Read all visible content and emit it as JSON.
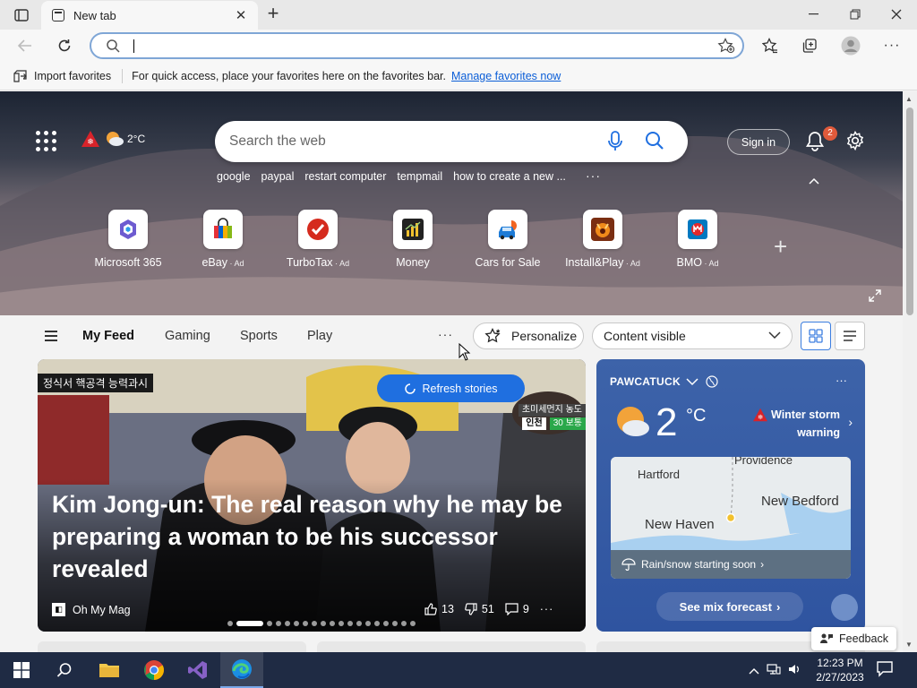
{
  "browser": {
    "tab_title": "New tab",
    "address_placeholder": "",
    "favorites_bar": {
      "import_label": "Import favorites",
      "message": "For quick access, place your favorites here on the favorites bar.",
      "manage_link": "Manage favorites now"
    }
  },
  "hero": {
    "weather_temp": "2°C",
    "search_placeholder": "Search the web",
    "trending": [
      "google",
      "paypal",
      "restart computer",
      "tempmail",
      "how to create a new ..."
    ],
    "sign_in_label": "Sign in",
    "notification_count": "2",
    "quick_links": [
      {
        "name": "Microsoft 365",
        "ad": ""
      },
      {
        "name": "eBay",
        "ad": " · Ad"
      },
      {
        "name": "TurboTax",
        "ad": " · Ad"
      },
      {
        "name": "Money",
        "ad": ""
      },
      {
        "name": "Cars for Sale",
        "ad": ""
      },
      {
        "name": "Install&Play",
        "ad": " · Ad"
      },
      {
        "name": "BMO",
        "ad": " · Ad"
      }
    ]
  },
  "feed_nav": {
    "tabs": [
      "My Feed",
      "Gaming",
      "Sports",
      "Play"
    ],
    "personalize_label": "Personalize",
    "content_dropdown": "Content visible"
  },
  "story": {
    "refresh_label": "Refresh stories",
    "headline": "Kim Jong-un: The real reason why he may be preparing a woman to be his successor revealed",
    "source": "Oh My Mag",
    "likes": "13",
    "dislikes": "51",
    "comments": "9",
    "overlay_text_left": "정식서 핵공격 능력과시",
    "overlay_text_right_1": "초미세먼지 농도",
    "overlay_text_right_2": "인천",
    "overlay_text_right_3": "30 보통"
  },
  "weather_card": {
    "location": "PAWCATUCK",
    "temperature": "2",
    "unit": "°C",
    "alert_line1": "Winter storm",
    "alert_line2": "warning",
    "map_labels": [
      "Hartford",
      "Providence",
      "New Bedford",
      "New Haven"
    ],
    "precip_text": "Rain/snow starting soon",
    "forecast_button": "See mix forecast"
  },
  "feedback_label": "Feedback",
  "taskbar": {
    "time": "12:23 PM",
    "date": "2/27/2023"
  },
  "colors": {
    "accent": "#1f6fe0",
    "weather_card": "#3d63a9",
    "taskbar": "#1f2b44",
    "badge": "#e05a3b",
    "link": "#0b5ed7"
  }
}
